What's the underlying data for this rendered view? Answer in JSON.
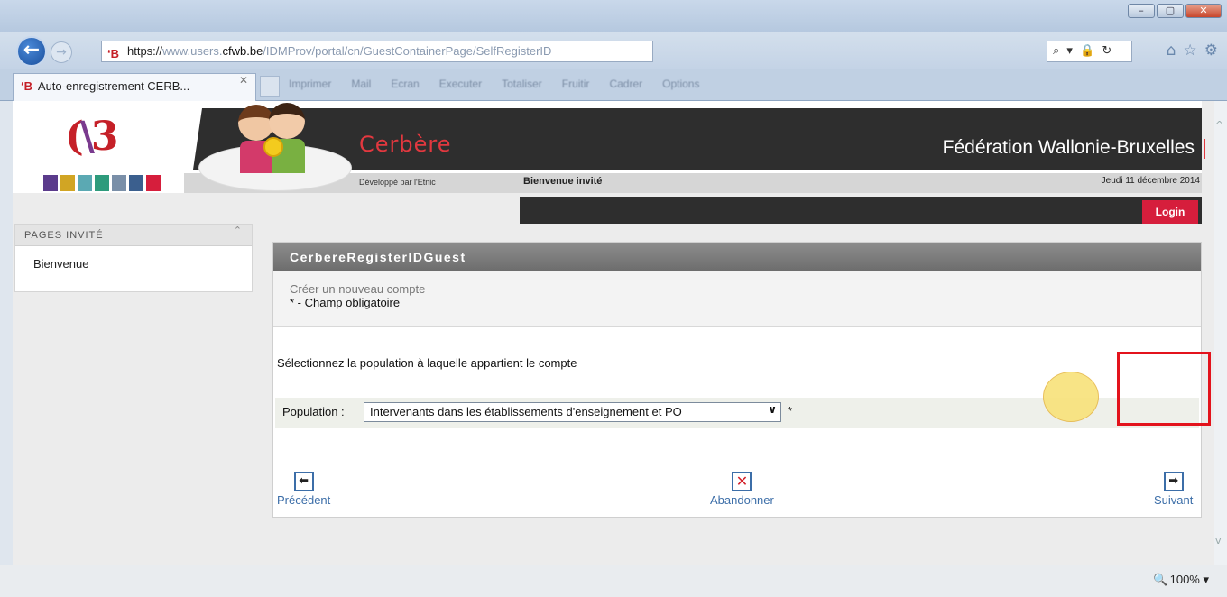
{
  "browser": {
    "url_scheme": "https://",
    "url_host": "www.users.",
    "url_domain": "cfwb.be",
    "url_path": "/IDMProv/portal/cn/GuestContainerPage/SelfRegisterID",
    "address_tools": "⌕ ▾ 🔒 ↻",
    "tab_title": "Auto-enregistrement CERB...",
    "favicon_text": "‘B",
    "zoom_level": "100%",
    "favorites_bar": [
      "Imprimer",
      "Mail",
      "Ecran",
      "Executer",
      "Totaliser",
      "Fruitir",
      "Cadrer",
      "Options"
    ]
  },
  "header": {
    "app_name": "Cerbère",
    "org_name": "Fédération Wallonie-Bruxelles",
    "developed_by": "Développé par l'Etnic",
    "welcome": "Bienvenue invité",
    "date": "Jeudi 11 décembre 2014",
    "login_label": "Login",
    "brand_colors": [
      "#5b3b8c",
      "#d1a524",
      "#5ba9b3",
      "#2e9b7c",
      "#7a8fa8",
      "#3b5f8e",
      "#d61e3c"
    ]
  },
  "sidebar": {
    "title": "PAGES INVITÉ",
    "items": [
      {
        "label": "Bienvenue"
      }
    ]
  },
  "portlet": {
    "title": "CerbereRegisterIDGuest",
    "intro_line1": "Créer un nouveau compte",
    "intro_line2": "* - Champ obligatoire",
    "prompt": "Sélectionnez la population à laquelle appartient le compte",
    "population_label": "Population :",
    "population_value": "Intervenants dans les établissements d'enseignement et PO",
    "required_mark": "*",
    "prev_label": "Précédent",
    "abort_label": "Abandonner",
    "next_label": "Suivant"
  },
  "colors": {
    "accent_red": "#d61e3c",
    "banner_dark": "#2e2e2e",
    "link_blue": "#3c6ea8"
  }
}
